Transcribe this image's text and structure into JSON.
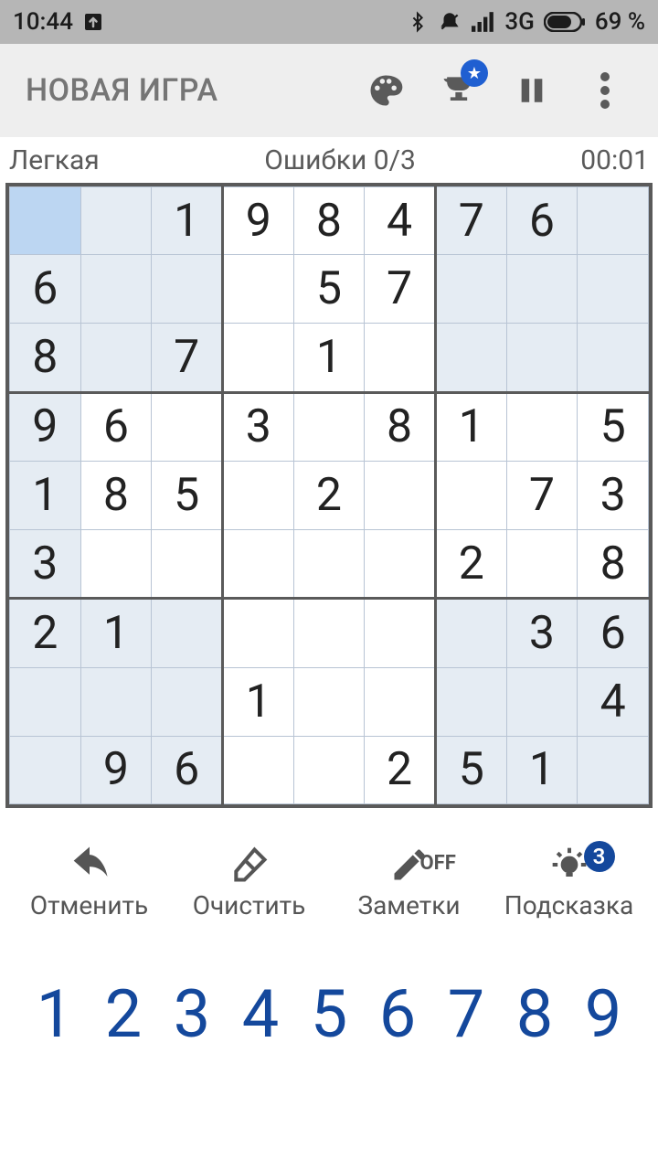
{
  "statusbar": {
    "time": "10:44",
    "network": "3G",
    "battery": "69 %"
  },
  "appbar": {
    "title": "НОВАЯ ИГРА"
  },
  "info": {
    "difficulty": "Легкая",
    "mistakes": "Ошибки 0/3",
    "timer": "00:01"
  },
  "board": {
    "selected": [
      0,
      0
    ],
    "cells": [
      [
        "",
        "",
        "1",
        "9",
        "8",
        "4",
        "7",
        "6",
        ""
      ],
      [
        "6",
        "",
        "",
        "",
        "5",
        "7",
        "",
        "",
        ""
      ],
      [
        "8",
        "",
        "7",
        "",
        "1",
        "",
        "",
        "",
        ""
      ],
      [
        "9",
        "6",
        "",
        "3",
        "",
        "8",
        "1",
        "",
        "5"
      ],
      [
        "1",
        "8",
        "5",
        "",
        "2",
        "",
        "",
        "7",
        "3"
      ],
      [
        "3",
        "",
        "",
        "",
        "",
        "",
        "2",
        "",
        "8"
      ],
      [
        "2",
        "1",
        "",
        "",
        "",
        "",
        "",
        "3",
        "6"
      ],
      [
        "",
        "",
        "",
        "1",
        "",
        "",
        "",
        "",
        "4"
      ],
      [
        "",
        "9",
        "6",
        "",
        "",
        "2",
        "5",
        "1",
        ""
      ]
    ]
  },
  "tools": {
    "undo": "Отменить",
    "erase": "Очистить",
    "notes": "Заметки",
    "notes_state": "OFF",
    "hint": "Подсказка",
    "hint_count": "3"
  },
  "pad": [
    "1",
    "2",
    "3",
    "4",
    "5",
    "6",
    "7",
    "8",
    "9"
  ]
}
